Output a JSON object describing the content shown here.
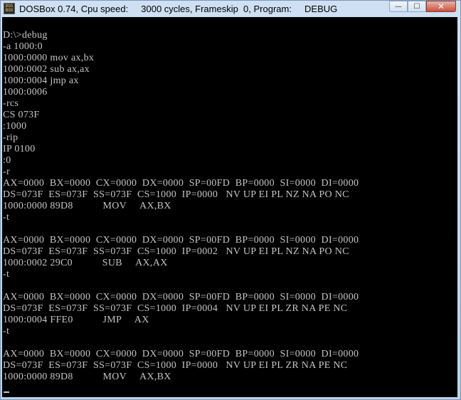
{
  "window": {
    "title": "DOSBox 0.74, Cpu speed:     3000 cycles, Frameskip  0, Program:     DEBUG",
    "icon_text": "DOS BOX",
    "minimize_glyph": "—",
    "maximize_glyph": "☐",
    "close_glyph": "✕"
  },
  "console": {
    "lines": [
      "D:\\>debug",
      "-a 1000:0",
      "1000:0000 mov ax,bx",
      "1000:0002 sub ax,ax",
      "1000:0004 jmp ax",
      "1000:0006",
      "-rcs",
      "CS 073F",
      ":1000",
      "-rip",
      "IP 0100",
      ":0",
      "-r",
      "AX=0000  BX=0000  CX=0000  DX=0000  SP=00FD  BP=0000  SI=0000  DI=0000",
      "DS=073F  ES=073F  SS=073F  CS=1000  IP=0000   NV UP EI PL NZ NA PO NC",
      "1000:0000 89D8           MOV     AX,BX",
      "-t",
      "",
      "AX=0000  BX=0000  CX=0000  DX=0000  SP=00FD  BP=0000  SI=0000  DI=0000",
      "DS=073F  ES=073F  SS=073F  CS=1000  IP=0002   NV UP EI PL NZ NA PO NC",
      "1000:0002 29C0           SUB     AX,AX",
      "-t",
      "",
      "AX=0000  BX=0000  CX=0000  DX=0000  SP=00FD  BP=0000  SI=0000  DI=0000",
      "DS=073F  ES=073F  SS=073F  CS=1000  IP=0004   NV UP EI PL ZR NA PE NC",
      "1000:0004 FFE0           JMP     AX",
      "-t",
      "",
      "AX=0000  BX=0000  CX=0000  DX=0000  SP=00FD  BP=0000  SI=0000  DI=0000",
      "DS=073F  ES=073F  SS=073F  CS=1000  IP=0000   NV UP EI PL ZR NA PE NC",
      "1000:0000 89D8           MOV     AX,BX"
    ]
  }
}
